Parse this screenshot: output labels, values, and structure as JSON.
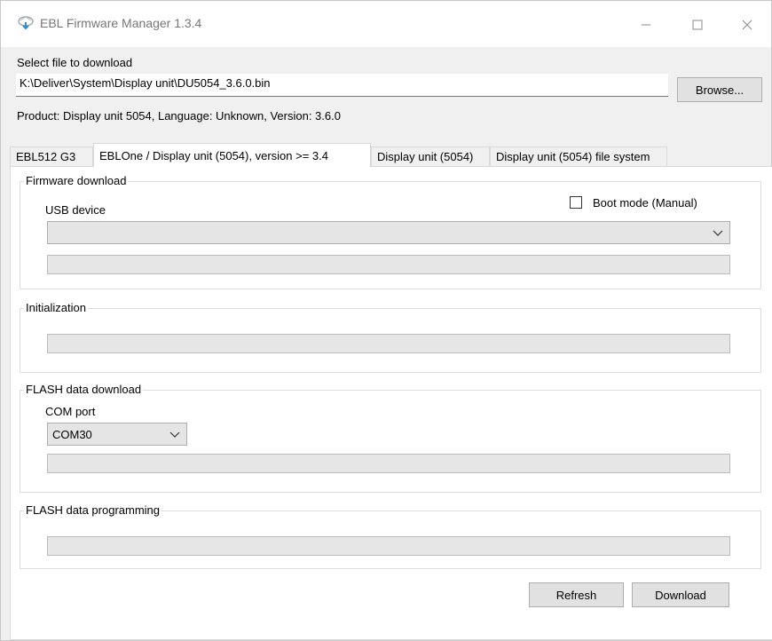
{
  "window": {
    "title": "EBL Firmware Manager 1.3.4",
    "controls": [
      "minimize",
      "maximize",
      "close"
    ]
  },
  "file": {
    "label": "Select file to download",
    "path": "K:\\Deliver\\System\\Display unit\\DU5054_3.6.0.bin",
    "browse_label": "Browse..."
  },
  "product_info": "Product: Display unit 5054, Language: Unknown, Version: 3.6.0",
  "tabs": [
    {
      "label": "EBL512 G3",
      "active": false
    },
    {
      "label": "EBLOne / Display unit (5054), version >= 3.4",
      "active": true
    },
    {
      "label": "Display unit (5054)",
      "active": false
    },
    {
      "label": "Display unit (5054) file system",
      "active": false
    }
  ],
  "firmware_download": {
    "title": "Firmware download",
    "usb_label": "USB device",
    "usb_value": "",
    "boot_mode_label": "Boot mode (Manual)",
    "boot_mode_checked": false,
    "progress": 0
  },
  "initialization": {
    "title": "Initialization",
    "progress": 0
  },
  "flash_download": {
    "title": "FLASH data download",
    "com_label": "COM port",
    "com_value": "COM30",
    "progress": 0
  },
  "flash_programming": {
    "title": "FLASH data programming",
    "progress": 0
  },
  "actions": {
    "refresh_label": "Refresh",
    "download_label": "Download"
  },
  "icons": {
    "app": "firmware-app-icon",
    "minimize": "minimize-icon",
    "maximize": "maximize-icon",
    "close": "close-icon",
    "dropdown": "chevron-down-icon"
  }
}
